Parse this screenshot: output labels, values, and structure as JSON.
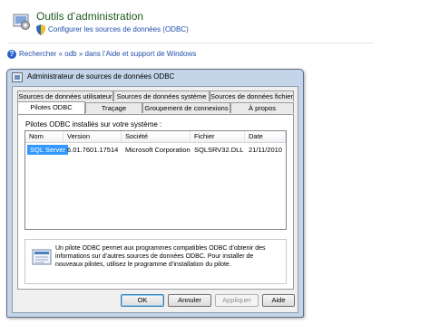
{
  "search_result": {
    "title": "Outils d’administration",
    "link": "Configurer les sources de données (ODBC)",
    "help_link": "Rechercher « odb » dans l’Aide et support de Windows",
    "help_icon_glyph": "?"
  },
  "dialog": {
    "title": "Administrateur de sources de données ODBC",
    "tabs_back": [
      "Sources de données utilisateur",
      "Sources de données système",
      "Sources de données fichier"
    ],
    "tabs_front": [
      "Pilotes ODBC",
      "Traçage",
      "Groupement de connexions",
      "À propos"
    ],
    "active_tab": "Pilotes ODBC",
    "installed_label": "Pilotes ODBC installés sur votre système :",
    "columns": [
      "Nom",
      "Version",
      "Société",
      "Fichier",
      "Date"
    ],
    "rows": [
      [
        "SQL Server",
        "6.01.7601.17514",
        "Microsoft Corporation",
        "SQLSRV32.DLL",
        "21/11/2010"
      ]
    ],
    "info_text": "Un pilote ODBC permet aux programmes compatibles ODBC d’obtenir des informations sur d’autres sources de données ODBC. Pour installer de nouveaux pilotes, utilisez le programme d’installation du pilote.",
    "buttons": {
      "ok": "OK",
      "cancel": "Annuler",
      "apply": "Appliquer",
      "help": "Aide"
    }
  },
  "colors": {
    "title_green": "#1e5a1e",
    "link_blue": "#1f4ea8",
    "selection": "#3399ff",
    "dialog_frame": "#c4d5ea"
  }
}
